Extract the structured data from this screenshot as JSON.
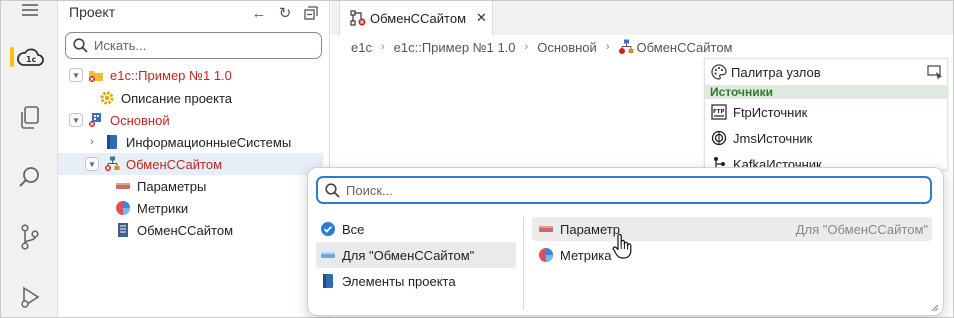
{
  "sidebar": {
    "title": "Проект",
    "search_placeholder": "Искать...",
    "tree": [
      {
        "label": "e1c::Пример №1 1.0",
        "red": true
      },
      {
        "label": "Описание проекта",
        "red": false
      },
      {
        "label": "Основной",
        "red": true
      },
      {
        "label": "ИнформационныеСистемы",
        "red": false
      },
      {
        "label": "ОбменССайтом",
        "red": true
      },
      {
        "label": "Параметры",
        "red": false
      },
      {
        "label": "Метрики",
        "red": false
      },
      {
        "label": "ОбменССайтом",
        "red": false
      }
    ]
  },
  "editor": {
    "tab_label": "ОбменССайтом",
    "breadcrumb": [
      "e1c",
      "e1c::Пример №1 1.0",
      "Основной",
      "ОбменССайтом"
    ]
  },
  "palette": {
    "title": "Палитра узлов",
    "section": "Источники",
    "items": [
      "FtpИсточник",
      "JmsИсточник",
      "KafkaИсточник"
    ]
  },
  "popup": {
    "search_placeholder": "Поиск...",
    "categories": [
      "Все",
      "Для \"ОбменССайтом\"",
      "Элементы проекта"
    ],
    "results": [
      {
        "label": "Параметр",
        "hint": "Для \"ОбменССайтом\""
      },
      {
        "label": "Метрика",
        "hint": ""
      }
    ]
  },
  "colors": {
    "accent": "#2f7bd1",
    "error": "#c0271e",
    "activity_highlight": "#f5c400",
    "section_green": "#2f7a2f"
  }
}
